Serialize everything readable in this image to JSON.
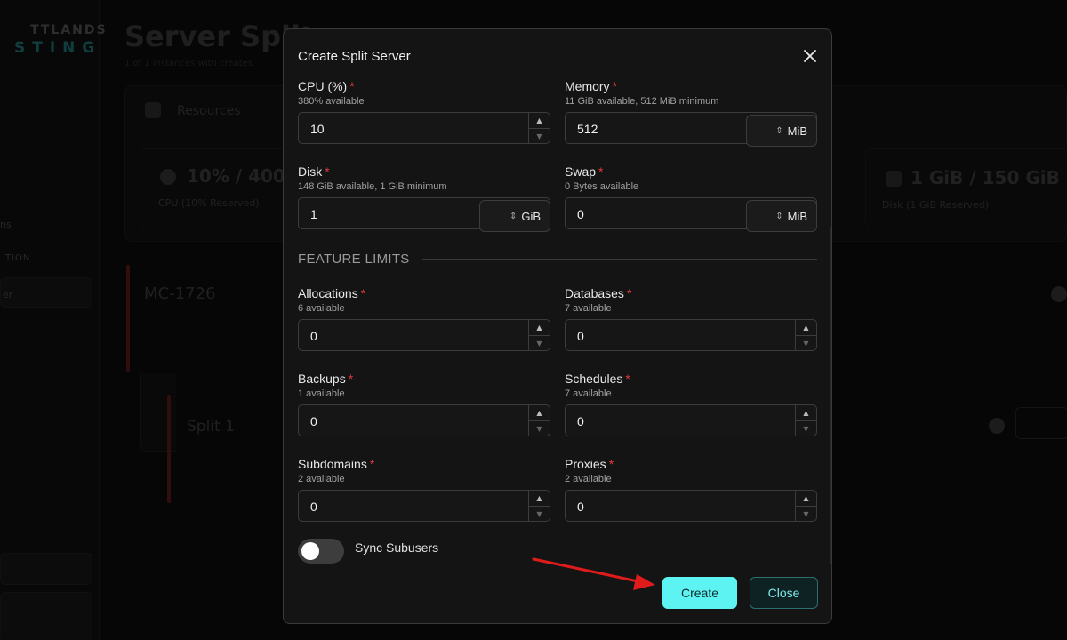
{
  "background": {
    "logo_top": "TTLANDS",
    "logo_bottom": "STING",
    "nav_fragment_1": "ns",
    "nav_fragment_2": "TION",
    "nav_fragment_3": "er",
    "page_title": "Server Split",
    "page_subtitle": "1 of 1 instances with creates",
    "resources_label": "Resources",
    "cpu_stat": "10% / 4001",
    "cpu_stat_sub": "CPU (10% Reserved)",
    "disk_stat": "1 GiB / 150 GiB",
    "disk_stat_sub": "Disk (1 GiB Reserved)",
    "server_name": "MC-1726",
    "split_name": "Split 1"
  },
  "modal": {
    "title": "Create Split Server",
    "fields": [
      {
        "label": "CPU (%)",
        "hint": "380% available",
        "value": "10"
      },
      {
        "label": "Memory",
        "hint": "11 GiB available, 512 MiB minimum",
        "value": "512",
        "unit": "MiB"
      },
      {
        "label": "Disk",
        "hint": "148 GiB available, 1 GiB minimum",
        "value": "1",
        "unit": "GiB"
      },
      {
        "label": "Swap",
        "hint": "0 Bytes available",
        "value": "0",
        "unit": "MiB"
      },
      {
        "label": "Allocations",
        "hint": "6 available",
        "value": "0"
      },
      {
        "label": "Databases",
        "hint": "7 available",
        "value": "0"
      },
      {
        "label": "Backups",
        "hint": "1 available",
        "value": "0"
      },
      {
        "label": "Schedules",
        "hint": "7 available",
        "value": "0"
      },
      {
        "label": "Subdomains",
        "hint": "2 available",
        "value": "0"
      },
      {
        "label": "Proxies",
        "hint": "2 available",
        "value": "0"
      }
    ],
    "required_marker": "*",
    "section_title": "FEATURE LIMITS",
    "sync_subusers_label": "Sync Subusers",
    "sync_subusers_on": false,
    "create_label": "Create",
    "close_label": "Close"
  },
  "colors": {
    "accent": "#5ef3f3",
    "required": "#e03a3a",
    "annotation_arrow": "#e01b1b"
  },
  "icons": {
    "close": "close-icon",
    "stepper_up": "chevron-up-icon",
    "stepper_down": "chevron-down-icon",
    "unit_select": "up-down-icon"
  }
}
